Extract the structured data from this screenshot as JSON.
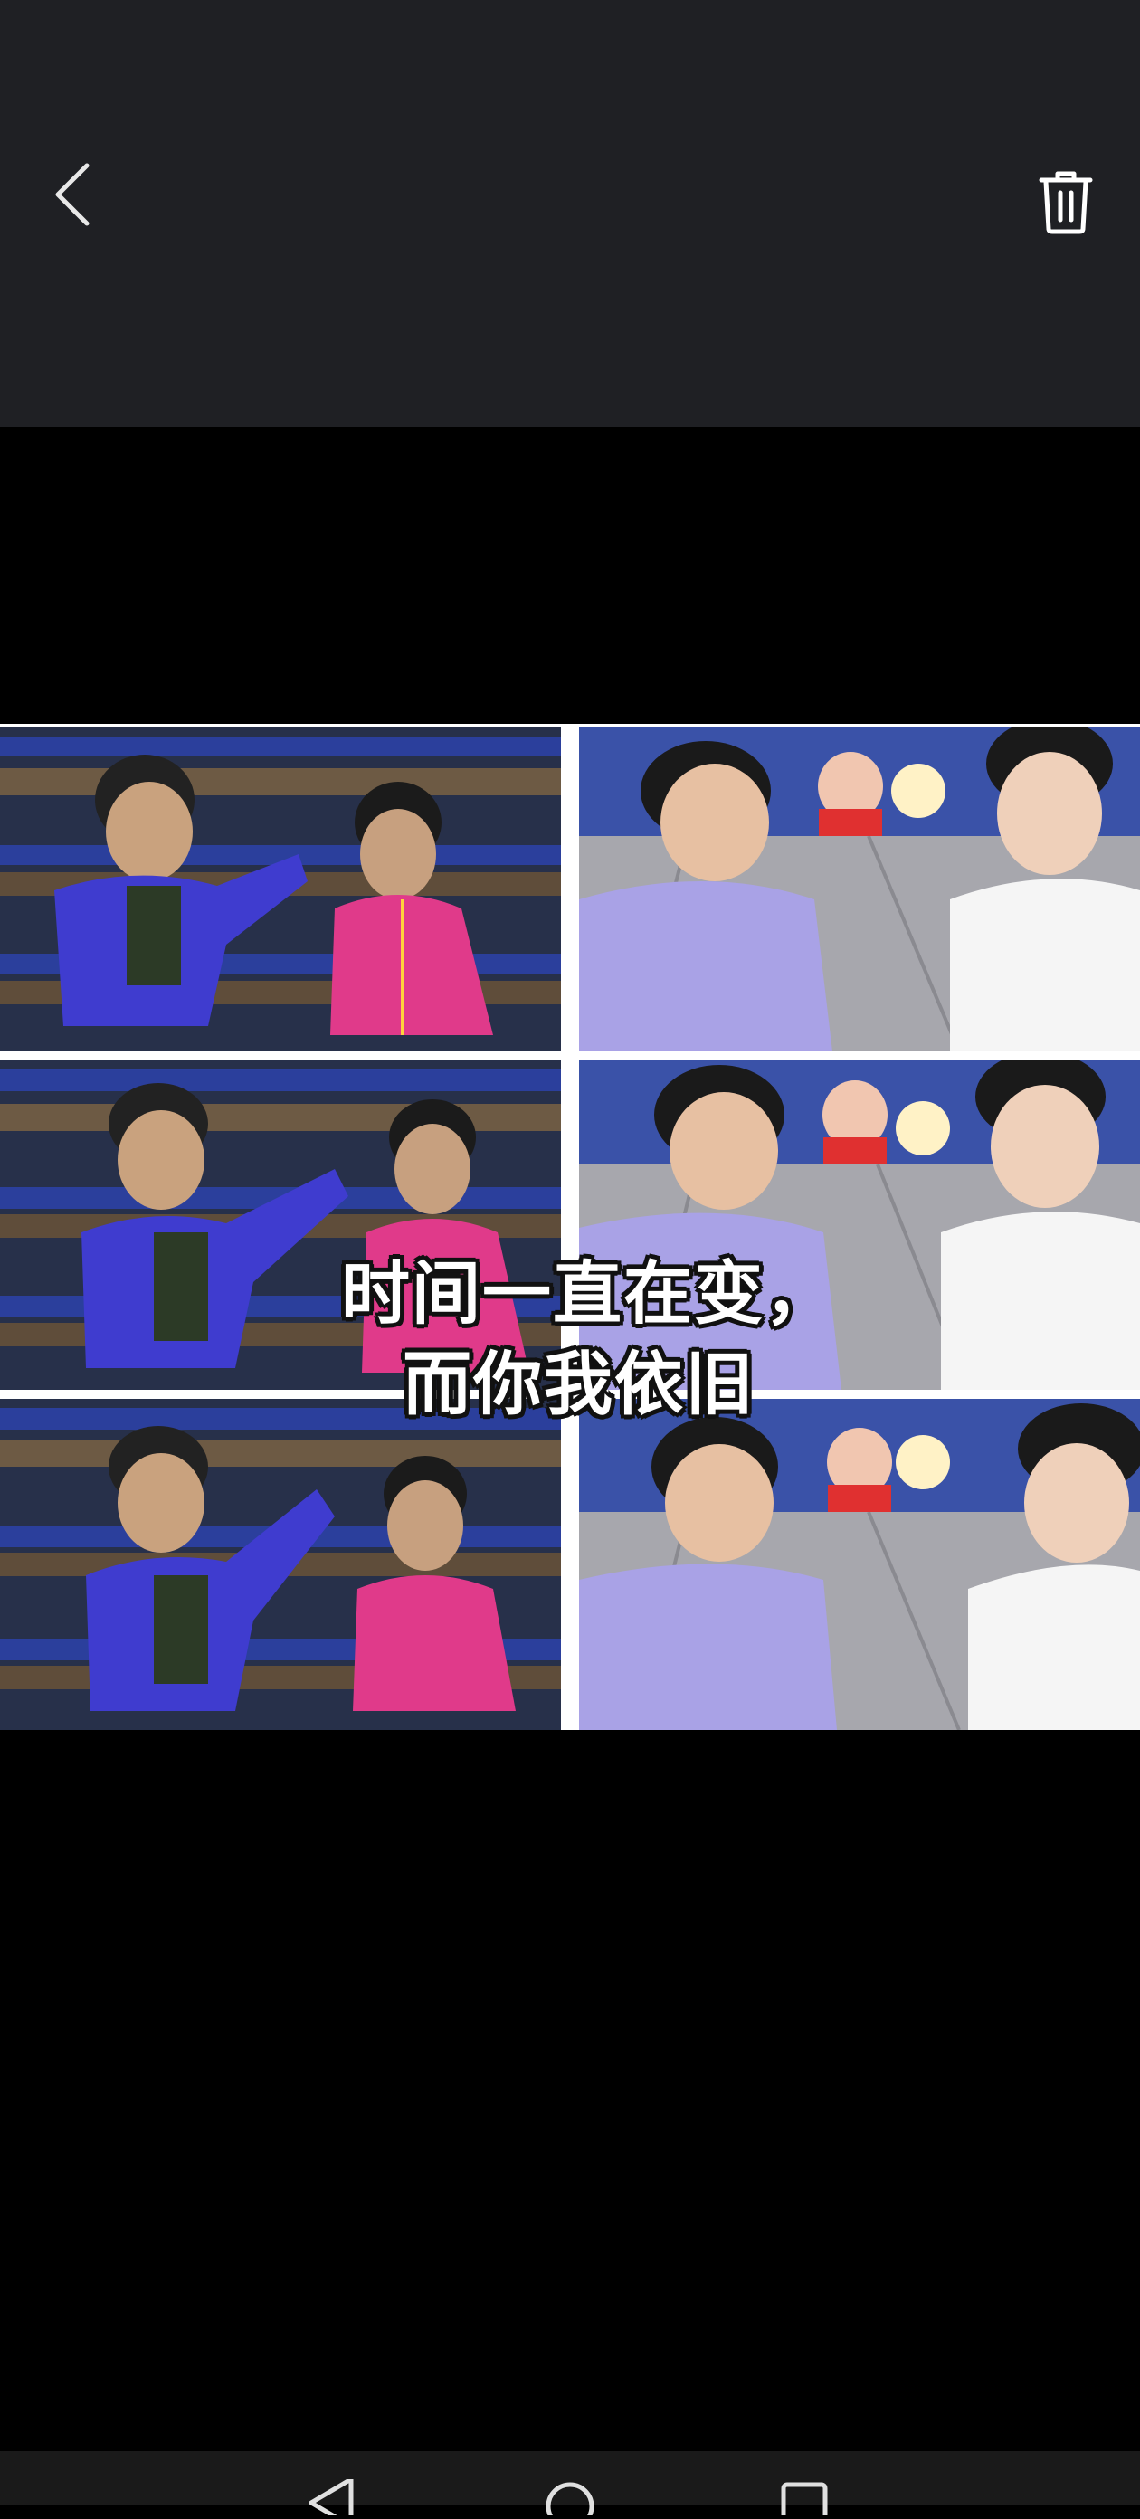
{
  "header": {
    "back_icon": "chevron-left-icon",
    "delete_icon": "trash-icon"
  },
  "image": {
    "caption_line1": "时间一直在变，",
    "caption_line2": "而你我依旧"
  },
  "colors": {
    "top_bar": "#1f2024",
    "background": "#000000",
    "icon": "#ffffff"
  },
  "navigation": {
    "icons": [
      "back-triangle-icon",
      "home-circle-icon",
      "recents-square-icon"
    ]
  }
}
